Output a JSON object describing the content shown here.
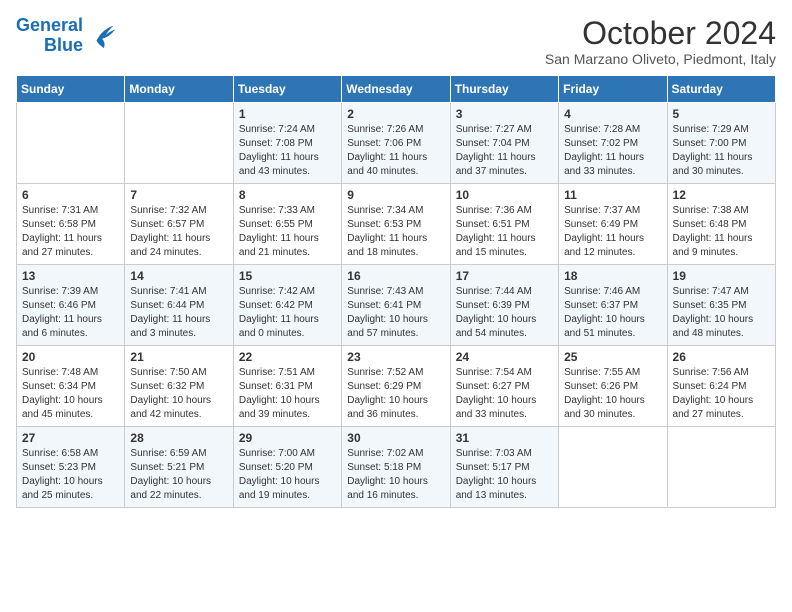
{
  "logo": {
    "line1": "General",
    "line2": "Blue"
  },
  "title": "October 2024",
  "subtitle": "San Marzano Oliveto, Piedmont, Italy",
  "headers": [
    "Sunday",
    "Monday",
    "Tuesday",
    "Wednesday",
    "Thursday",
    "Friday",
    "Saturday"
  ],
  "weeks": [
    [
      {
        "day": "",
        "sunrise": "",
        "sunset": "",
        "daylight": ""
      },
      {
        "day": "",
        "sunrise": "",
        "sunset": "",
        "daylight": ""
      },
      {
        "day": "1",
        "sunrise": "Sunrise: 7:24 AM",
        "sunset": "Sunset: 7:08 PM",
        "daylight": "Daylight: 11 hours and 43 minutes."
      },
      {
        "day": "2",
        "sunrise": "Sunrise: 7:26 AM",
        "sunset": "Sunset: 7:06 PM",
        "daylight": "Daylight: 11 hours and 40 minutes."
      },
      {
        "day": "3",
        "sunrise": "Sunrise: 7:27 AM",
        "sunset": "Sunset: 7:04 PM",
        "daylight": "Daylight: 11 hours and 37 minutes."
      },
      {
        "day": "4",
        "sunrise": "Sunrise: 7:28 AM",
        "sunset": "Sunset: 7:02 PM",
        "daylight": "Daylight: 11 hours and 33 minutes."
      },
      {
        "day": "5",
        "sunrise": "Sunrise: 7:29 AM",
        "sunset": "Sunset: 7:00 PM",
        "daylight": "Daylight: 11 hours and 30 minutes."
      }
    ],
    [
      {
        "day": "6",
        "sunrise": "Sunrise: 7:31 AM",
        "sunset": "Sunset: 6:58 PM",
        "daylight": "Daylight: 11 hours and 27 minutes."
      },
      {
        "day": "7",
        "sunrise": "Sunrise: 7:32 AM",
        "sunset": "Sunset: 6:57 PM",
        "daylight": "Daylight: 11 hours and 24 minutes."
      },
      {
        "day": "8",
        "sunrise": "Sunrise: 7:33 AM",
        "sunset": "Sunset: 6:55 PM",
        "daylight": "Daylight: 11 hours and 21 minutes."
      },
      {
        "day": "9",
        "sunrise": "Sunrise: 7:34 AM",
        "sunset": "Sunset: 6:53 PM",
        "daylight": "Daylight: 11 hours and 18 minutes."
      },
      {
        "day": "10",
        "sunrise": "Sunrise: 7:36 AM",
        "sunset": "Sunset: 6:51 PM",
        "daylight": "Daylight: 11 hours and 15 minutes."
      },
      {
        "day": "11",
        "sunrise": "Sunrise: 7:37 AM",
        "sunset": "Sunset: 6:49 PM",
        "daylight": "Daylight: 11 hours and 12 minutes."
      },
      {
        "day": "12",
        "sunrise": "Sunrise: 7:38 AM",
        "sunset": "Sunset: 6:48 PM",
        "daylight": "Daylight: 11 hours and 9 minutes."
      }
    ],
    [
      {
        "day": "13",
        "sunrise": "Sunrise: 7:39 AM",
        "sunset": "Sunset: 6:46 PM",
        "daylight": "Daylight: 11 hours and 6 minutes."
      },
      {
        "day": "14",
        "sunrise": "Sunrise: 7:41 AM",
        "sunset": "Sunset: 6:44 PM",
        "daylight": "Daylight: 11 hours and 3 minutes."
      },
      {
        "day": "15",
        "sunrise": "Sunrise: 7:42 AM",
        "sunset": "Sunset: 6:42 PM",
        "daylight": "Daylight: 11 hours and 0 minutes."
      },
      {
        "day": "16",
        "sunrise": "Sunrise: 7:43 AM",
        "sunset": "Sunset: 6:41 PM",
        "daylight": "Daylight: 10 hours and 57 minutes."
      },
      {
        "day": "17",
        "sunrise": "Sunrise: 7:44 AM",
        "sunset": "Sunset: 6:39 PM",
        "daylight": "Daylight: 10 hours and 54 minutes."
      },
      {
        "day": "18",
        "sunrise": "Sunrise: 7:46 AM",
        "sunset": "Sunset: 6:37 PM",
        "daylight": "Daylight: 10 hours and 51 minutes."
      },
      {
        "day": "19",
        "sunrise": "Sunrise: 7:47 AM",
        "sunset": "Sunset: 6:35 PM",
        "daylight": "Daylight: 10 hours and 48 minutes."
      }
    ],
    [
      {
        "day": "20",
        "sunrise": "Sunrise: 7:48 AM",
        "sunset": "Sunset: 6:34 PM",
        "daylight": "Daylight: 10 hours and 45 minutes."
      },
      {
        "day": "21",
        "sunrise": "Sunrise: 7:50 AM",
        "sunset": "Sunset: 6:32 PM",
        "daylight": "Daylight: 10 hours and 42 minutes."
      },
      {
        "day": "22",
        "sunrise": "Sunrise: 7:51 AM",
        "sunset": "Sunset: 6:31 PM",
        "daylight": "Daylight: 10 hours and 39 minutes."
      },
      {
        "day": "23",
        "sunrise": "Sunrise: 7:52 AM",
        "sunset": "Sunset: 6:29 PM",
        "daylight": "Daylight: 10 hours and 36 minutes."
      },
      {
        "day": "24",
        "sunrise": "Sunrise: 7:54 AM",
        "sunset": "Sunset: 6:27 PM",
        "daylight": "Daylight: 10 hours and 33 minutes."
      },
      {
        "day": "25",
        "sunrise": "Sunrise: 7:55 AM",
        "sunset": "Sunset: 6:26 PM",
        "daylight": "Daylight: 10 hours and 30 minutes."
      },
      {
        "day": "26",
        "sunrise": "Sunrise: 7:56 AM",
        "sunset": "Sunset: 6:24 PM",
        "daylight": "Daylight: 10 hours and 27 minutes."
      }
    ],
    [
      {
        "day": "27",
        "sunrise": "Sunrise: 6:58 AM",
        "sunset": "Sunset: 5:23 PM",
        "daylight": "Daylight: 10 hours and 25 minutes."
      },
      {
        "day": "28",
        "sunrise": "Sunrise: 6:59 AM",
        "sunset": "Sunset: 5:21 PM",
        "daylight": "Daylight: 10 hours and 22 minutes."
      },
      {
        "day": "29",
        "sunrise": "Sunrise: 7:00 AM",
        "sunset": "Sunset: 5:20 PM",
        "daylight": "Daylight: 10 hours and 19 minutes."
      },
      {
        "day": "30",
        "sunrise": "Sunrise: 7:02 AM",
        "sunset": "Sunset: 5:18 PM",
        "daylight": "Daylight: 10 hours and 16 minutes."
      },
      {
        "day": "31",
        "sunrise": "Sunrise: 7:03 AM",
        "sunset": "Sunset: 5:17 PM",
        "daylight": "Daylight: 10 hours and 13 minutes."
      },
      {
        "day": "",
        "sunrise": "",
        "sunset": "",
        "daylight": ""
      },
      {
        "day": "",
        "sunrise": "",
        "sunset": "",
        "daylight": ""
      }
    ]
  ]
}
